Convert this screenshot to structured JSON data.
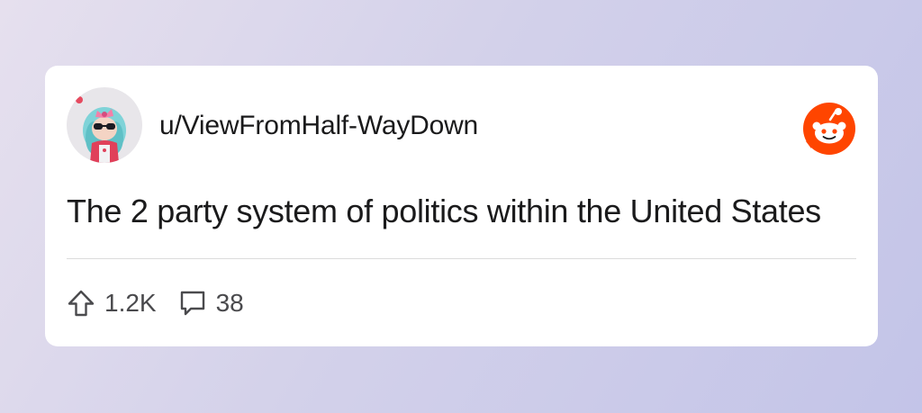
{
  "post": {
    "username": "u/ViewFromHalf-WayDown",
    "title": "The 2 party system of politics within the United States",
    "upvotes": "1.2K",
    "comments": "38"
  },
  "icons": {
    "brand": "reddit-logo-icon",
    "upvote": "upvote-arrow-icon",
    "comment": "comment-bubble-icon"
  },
  "colors": {
    "brand": "#ff4500",
    "card": "#ffffff",
    "text": "#1a1a1b",
    "meta_text": "#4a4a4d"
  }
}
